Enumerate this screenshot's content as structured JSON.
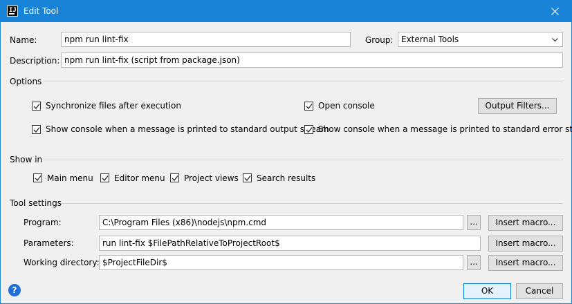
{
  "window": {
    "title": "Edit Tool",
    "app_icon": "intellij-icon",
    "close_icon": "close-icon"
  },
  "form": {
    "name_label": "Name:",
    "name_value": "npm run lint-fix",
    "group_label": "Group:",
    "group_value": "External Tools",
    "description_label": "Description:",
    "description_value": "npm run lint-fix (script from package.json)"
  },
  "options": {
    "heading": "Options",
    "sync_files": {
      "label": "Synchronize files after execution",
      "checked": true
    },
    "open_console": {
      "label": "Open console",
      "checked": true
    },
    "show_console_stdout": {
      "label": "Show console when a message is printed to standard output stream",
      "checked": true
    },
    "show_console_stderr": {
      "label": "Show console when a message is printed to standard error stream",
      "checked": true
    },
    "output_filters_label": "Output Filters..."
  },
  "show_in": {
    "heading": "Show in",
    "items": [
      {
        "label": "Main menu",
        "checked": true
      },
      {
        "label": "Editor menu",
        "checked": true
      },
      {
        "label": "Project views",
        "checked": true
      },
      {
        "label": "Search results",
        "checked": true
      }
    ]
  },
  "tool_settings": {
    "heading": "Tool settings",
    "program_label": "Program:",
    "program_value": "C:\\Program Files (x86)\\nodejs\\npm.cmd",
    "parameters_label": "Parameters:",
    "parameters_value": "run lint-fix $FilePathRelativeToProjectRoot$",
    "working_dir_label": "Working directory:",
    "working_dir_value": "$ProjectFileDir$",
    "browse_label": "...",
    "insert_macro_label": "Insert macro..."
  },
  "footer": {
    "help_label": "?",
    "ok_label": "OK",
    "cancel_label": "Cancel"
  },
  "colors": {
    "titlebar": "#1883d7",
    "accent": "#0078d7",
    "help_icon": "#1e6fd9"
  }
}
